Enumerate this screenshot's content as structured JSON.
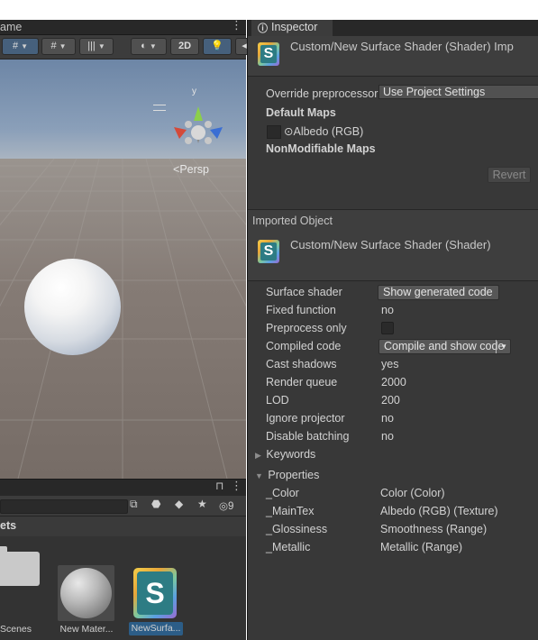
{
  "scene": {
    "tab_label": "ame",
    "tab_menu": "⋮",
    "toolbar": {
      "toggle_2d": "2D"
    },
    "persp_label": "Persp",
    "gizmo_axis_y": "y"
  },
  "project": {
    "lock_icon": "🔒",
    "menu": "⋮",
    "hidden_count": "9",
    "assets_title": "ets",
    "assets": [
      {
        "label": "Scenes",
        "kind": "folder"
      },
      {
        "label": "New Mater...",
        "kind": "material"
      },
      {
        "label": "NewSurfa...",
        "kind": "shader",
        "selected": true
      }
    ]
  },
  "inspector": {
    "tab_label": "Inspector",
    "header_title": "Custom/New Surface Shader (Shader) Imp",
    "override_preprocessor": {
      "label": "Override preprocessor",
      "value": "Use Project Settings"
    },
    "default_maps_title": "Default Maps",
    "albedo_map_label": "Albedo (RGB)",
    "nonmodifiable_title": "NonModifiable Maps",
    "revert_label": "Revert",
    "imported_object_title": "Imported Object",
    "shader_title": "Custom/New Surface Shader (Shader)",
    "rows": [
      {
        "label": "Surface shader",
        "value": "Show generated code",
        "type": "button"
      },
      {
        "label": "Fixed function",
        "value": "no",
        "type": "text"
      },
      {
        "label": "Preprocess only",
        "value": "",
        "type": "checkbox"
      },
      {
        "label": "Compiled code",
        "value": "Compile and show code",
        "type": "dropdown-button"
      },
      {
        "label": "Cast shadows",
        "value": "yes",
        "type": "text"
      },
      {
        "label": "Render queue",
        "value": "2000",
        "type": "text"
      },
      {
        "label": "LOD",
        "value": "200",
        "type": "text"
      },
      {
        "label": "Ignore projector",
        "value": "no",
        "type": "text"
      },
      {
        "label": "Disable batching",
        "value": "no",
        "type": "text"
      }
    ],
    "keywords_label": "Keywords",
    "properties_label": "Properties",
    "properties": [
      {
        "name": "_Color",
        "value": "Color (Color)"
      },
      {
        "name": "_MainTex",
        "value": "Albedo (RGB) (Texture)"
      },
      {
        "name": "_Glossiness",
        "value": "Smoothness (Range)"
      },
      {
        "name": "_Metallic",
        "value": "Metallic (Range)"
      }
    ]
  },
  "colors": {
    "panel_bg": "#383838",
    "toolbar_bg": "#3c3c3c",
    "accent_blue": "#46607c",
    "text": "#d2d2d2"
  }
}
